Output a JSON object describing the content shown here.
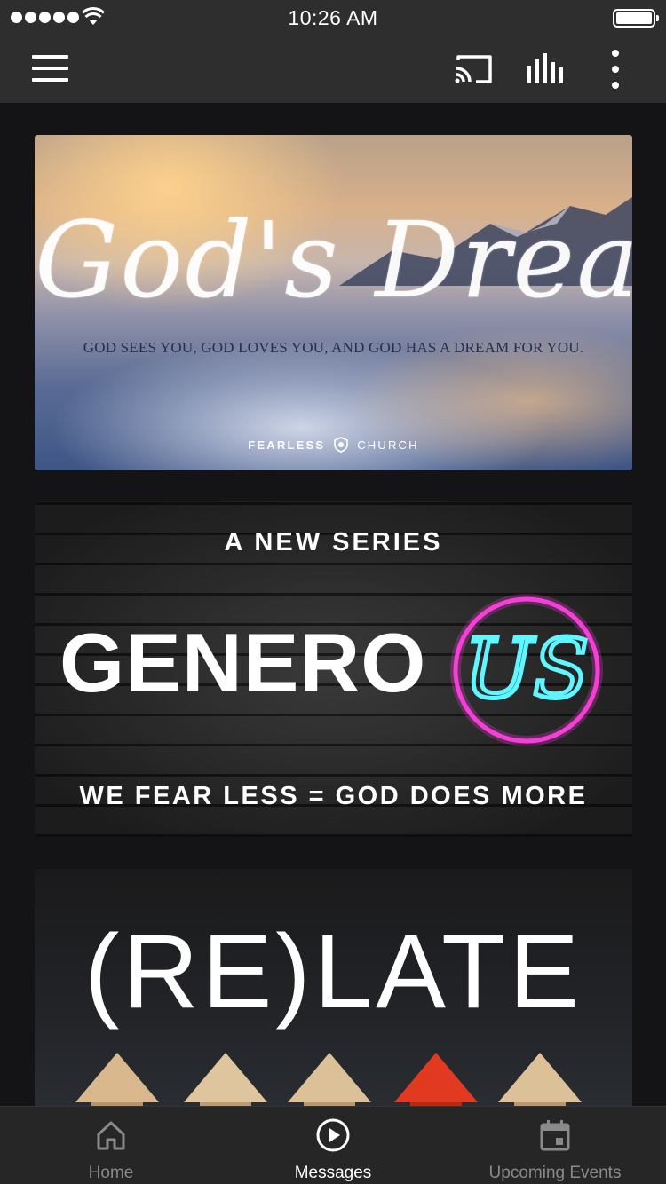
{
  "status_bar": {
    "time": "10:26 AM"
  },
  "toolbar": {
    "menu_icon": "hamburger-menu-icon",
    "cast_icon": "cast-icon",
    "audio_icon": "equalizer-icon",
    "more_icon": "vertical-dots-icon"
  },
  "series": [
    {
      "title": "God's Dream",
      "subtitle": "GOD SEES YOU, GOD LOVES YOU, AND GOD HAS A DREAM FOR YOU.",
      "brand_left": "FEARLESS",
      "brand_right": "CHURCH"
    },
    {
      "kicker": "A NEW SERIES",
      "title_main": "GENERO",
      "title_neon": "US",
      "tagline": "WE FEAR LESS = GOD DOES MORE"
    },
    {
      "title": "(RE)LATE"
    }
  ],
  "tab_bar": {
    "tabs": [
      {
        "label": "Home",
        "icon": "home-icon",
        "active": false
      },
      {
        "label": "Messages",
        "icon": "play-circle-icon",
        "active": true
      },
      {
        "label": "Upcoming Events",
        "icon": "calendar-icon",
        "active": false
      }
    ]
  },
  "colors": {
    "bar_background": "#2e2e2e",
    "page_background": "#141416",
    "neon_pink": "#ff3fe0",
    "neon_cyan": "#5ff6ff",
    "active_tab": "#ffffff",
    "inactive_tab": "#8a8a8a"
  }
}
